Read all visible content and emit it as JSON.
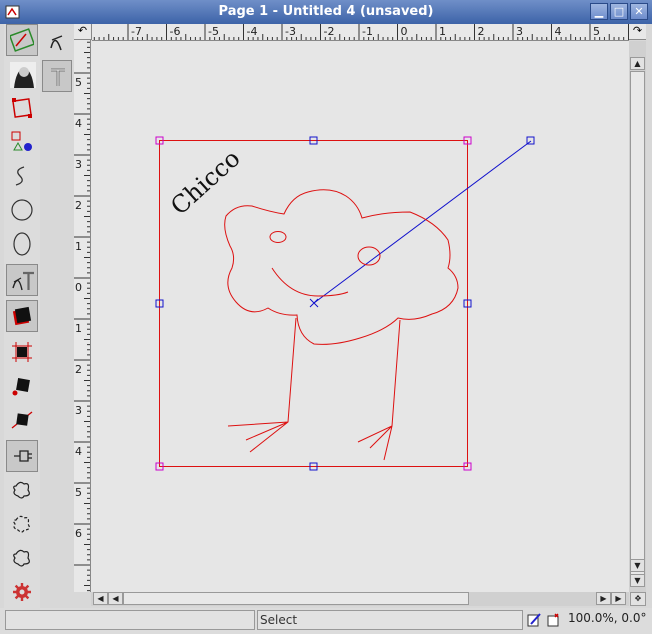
{
  "window": {
    "title": "Page 1 - Untitled 4 (unsaved)",
    "minimize_label": "▁",
    "maximize_label": "□",
    "close_label": "✕"
  },
  "toolbox": {
    "tools": [
      {
        "name": "selector-tool",
        "icon": "selector-icon",
        "active": true
      },
      {
        "name": "zoom-tool",
        "icon": "portrait-icon",
        "active": false
      },
      {
        "name": "rectangle-tool",
        "icon": "rectangle-icon",
        "active": false
      },
      {
        "name": "shapes-tool",
        "icon": "shapes-icon",
        "active": false
      },
      {
        "name": "freehand-tool",
        "icon": "freehand-icon",
        "active": false
      },
      {
        "name": "circle-tool",
        "icon": "circle-icon",
        "active": false
      },
      {
        "name": "ellipse-tool",
        "icon": "ellipse-icon",
        "active": false
      },
      {
        "name": "text-transform-tool",
        "icon": "text-tool-icon",
        "active": true
      },
      {
        "name": "fill-tool",
        "icon": "fill-icon",
        "active": true
      },
      {
        "name": "grid-object-tool",
        "icon": "grid-object-icon",
        "active": false
      },
      {
        "name": "object-point-tool",
        "icon": "object-point-icon",
        "active": false
      },
      {
        "name": "object-line-tool",
        "icon": "object-line-icon",
        "active": false
      },
      {
        "name": "align-tool",
        "icon": "align-icon",
        "active": true
      },
      {
        "name": "blob-tool-1",
        "icon": "blob-icon",
        "active": false
      },
      {
        "name": "blob-tool-2",
        "icon": "blob-dashed-icon",
        "active": false
      },
      {
        "name": "blob-tool-3",
        "icon": "blob-dotted-icon",
        "active": false
      },
      {
        "name": "settings-tool",
        "icon": "gear-icon",
        "active": false
      }
    ]
  },
  "subtools": [
    {
      "name": "curve-subtool",
      "icon": "x-curve-icon",
      "active": false
    },
    {
      "name": "text-subtool",
      "icon": "t-icon",
      "active": true
    }
  ],
  "rulers": {
    "horizontal": [
      "-7",
      "-6",
      "-5",
      "-4",
      "-3",
      "-2",
      "-1",
      "0",
      "1",
      "2",
      "3",
      "4",
      "5",
      "6"
    ],
    "vertical": [
      "5",
      "4",
      "3",
      "2",
      "1",
      "0",
      "1",
      "2",
      "3",
      "4",
      "5",
      "6"
    ]
  },
  "canvas": {
    "text_label": "Chicco",
    "accent_red": "#dd1111",
    "accent_blue": "#1111cc",
    "handle_magenta": "#cc00cc"
  },
  "statusbar": {
    "tool_text": "Select",
    "zoom_text": "100.0%, 0.0°"
  }
}
